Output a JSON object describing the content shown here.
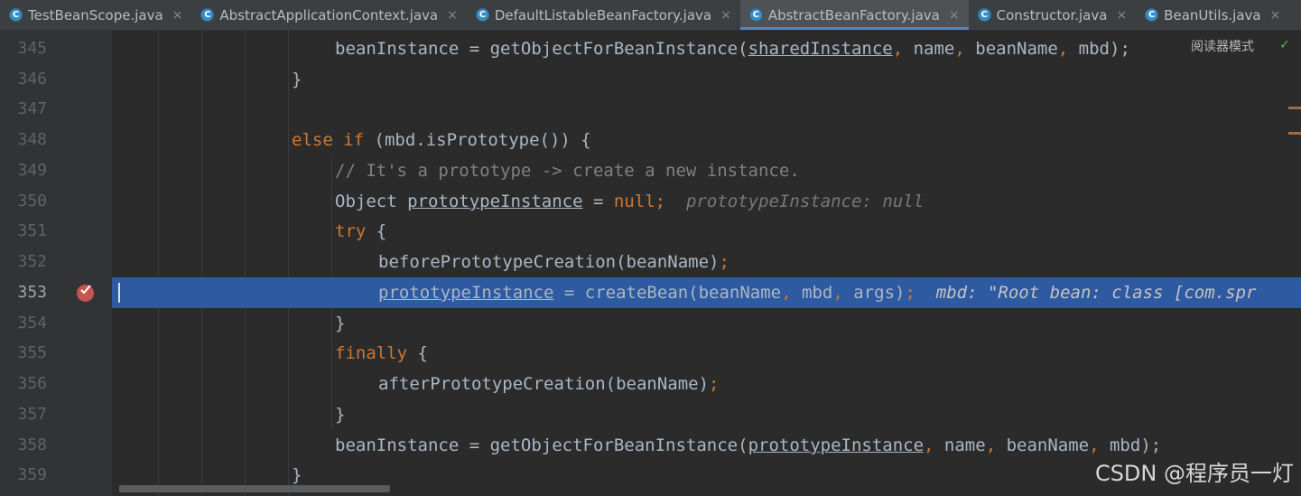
{
  "tabs": [
    {
      "label": "TestBeanScope.java",
      "active": false,
      "closable": true
    },
    {
      "label": "AbstractApplicationContext.java",
      "active": false,
      "closable": true
    },
    {
      "label": "DefaultListableBeanFactory.java",
      "active": false,
      "closable": true
    },
    {
      "label": "AbstractBeanFactory.java",
      "active": true,
      "closable": true
    },
    {
      "label": "Constructor.java",
      "active": false,
      "closable": true
    },
    {
      "label": "BeanUtils.java",
      "active": false,
      "closable": true
    }
  ],
  "editor": {
    "reader_mode_label": "阅读器模式",
    "current_line": "353",
    "lines": [
      {
        "num": "345",
        "tokens": [
          "beanInstance = getObjectForBeanInstance(",
          "sharedInstance",
          ", ",
          "name",
          ", ",
          "beanName",
          ", ",
          "mbd",
          ");"
        ]
      },
      {
        "num": "346",
        "tokens": [
          "}"
        ]
      },
      {
        "num": "347",
        "tokens": [
          ""
        ]
      },
      {
        "num": "348",
        "tokens": [
          "else if",
          " (mbd.isPrototype()) {"
        ]
      },
      {
        "num": "349",
        "tokens": [
          "// It's a prototype -> create a new instance."
        ]
      },
      {
        "num": "350",
        "tokens": [
          "Object ",
          "prototypeInstance",
          " = ",
          "null",
          ";",
          "prototypeInstance: null"
        ]
      },
      {
        "num": "351",
        "tokens": [
          "try",
          " {"
        ]
      },
      {
        "num": "352",
        "tokens": [
          "beforePrototypeCreation(beanName)",
          ";"
        ]
      },
      {
        "num": "353",
        "tokens": [
          "prototypeInstance",
          " = createBean(beanName",
          ", ",
          "mbd",
          ", ",
          "args)",
          ";",
          "mbd: \"Root bean: class [com.spr"
        ]
      },
      {
        "num": "354",
        "tokens": [
          "}"
        ]
      },
      {
        "num": "355",
        "tokens": [
          "finally",
          " {"
        ]
      },
      {
        "num": "356",
        "tokens": [
          "afterPrototypeCreation(beanName)",
          ";"
        ]
      },
      {
        "num": "357",
        "tokens": [
          "}"
        ]
      },
      {
        "num": "358",
        "tokens": [
          "beanInstance = getObjectForBeanInstance(",
          "prototypeInstance",
          ", ",
          "name",
          ", ",
          "beanName",
          ", ",
          "mbd",
          ");"
        ]
      },
      {
        "num": "359",
        "tokens": [
          "}"
        ]
      }
    ]
  },
  "watermark": "CSDN @程序员一灯",
  "colors": {
    "keyword": "#cc7832",
    "comment": "#808080",
    "text": "#a9b7c6",
    "selection": "#2d5aa0",
    "breakpoint": "#c75450"
  }
}
